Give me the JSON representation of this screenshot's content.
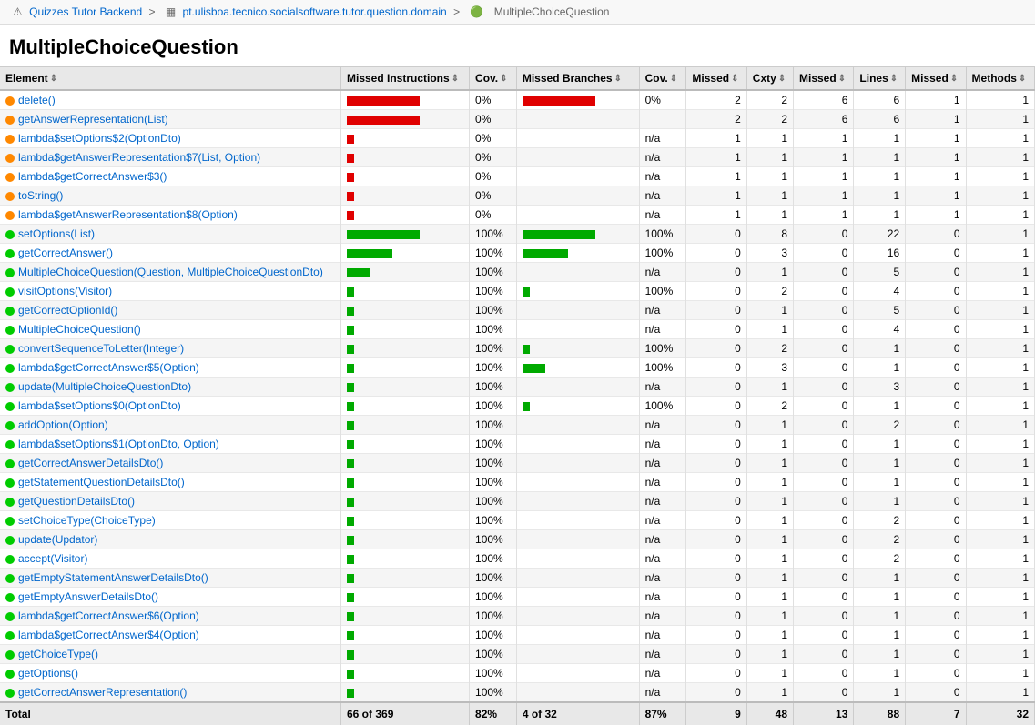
{
  "breadcrumb": {
    "items": [
      {
        "label": "Quizzes Tutor Backend",
        "url": "#"
      },
      {
        "label": "pt.ulisboa.tecnico.socialsoftware.tutor.question.domain",
        "url": "#"
      },
      {
        "label": "MultipleChoiceQuestion",
        "url": "#"
      }
    ]
  },
  "page_title": "MultipleChoiceQuestion",
  "table": {
    "columns": [
      {
        "id": "element",
        "label": "Element",
        "sortable": true
      },
      {
        "id": "missed_instr",
        "label": "Missed Instructions",
        "sortable": true
      },
      {
        "id": "cov_instr",
        "label": "Cov.",
        "sortable": true
      },
      {
        "id": "missed_branches",
        "label": "Missed Branches",
        "sortable": true
      },
      {
        "id": "cov_branches",
        "label": "Cov.",
        "sortable": true
      },
      {
        "id": "missed_cxty",
        "label": "Missed",
        "sortable": true
      },
      {
        "id": "cxty",
        "label": "Cxty",
        "sortable": true
      },
      {
        "id": "missed_lines",
        "label": "Missed",
        "sortable": true
      },
      {
        "id": "lines",
        "label": "Lines",
        "sortable": true
      },
      {
        "id": "missed_methods",
        "label": "Missed",
        "sortable": true
      },
      {
        "id": "methods",
        "label": "Methods",
        "sortable": true
      }
    ],
    "rows": [
      {
        "element": "delete()",
        "dot": "orange",
        "missed_instr_bar": "full_red",
        "cov_instr": "0%",
        "missed_branches_bar": "full_red",
        "cov_branches": "0%",
        "missed_cxty": "2",
        "cxty": "2",
        "missed_lines": "6",
        "lines": "6",
        "missed_methods": "1",
        "methods": "1"
      },
      {
        "element": "getAnswerRepresentation(List)",
        "dot": "orange",
        "missed_instr_bar": "full_red",
        "cov_instr": "0%",
        "missed_branches_bar": "none",
        "cov_branches": "",
        "missed_cxty": "2",
        "cxty": "2",
        "missed_lines": "6",
        "lines": "6",
        "missed_methods": "1",
        "methods": "1"
      },
      {
        "element": "lambda$setOptions$2(OptionDto)",
        "dot": "orange",
        "missed_instr_bar": "tiny_red",
        "cov_instr": "0%",
        "missed_branches_bar": "none",
        "cov_branches": "n/a",
        "missed_cxty": "1",
        "cxty": "1",
        "missed_lines": "1",
        "lines": "1",
        "missed_methods": "1",
        "methods": "1"
      },
      {
        "element": "lambda$getAnswerRepresentation$7(List, Option)",
        "dot": "orange",
        "missed_instr_bar": "tiny_red",
        "cov_instr": "0%",
        "missed_branches_bar": "none",
        "cov_branches": "n/a",
        "missed_cxty": "1",
        "cxty": "1",
        "missed_lines": "1",
        "lines": "1",
        "missed_methods": "1",
        "methods": "1"
      },
      {
        "element": "lambda$getCorrectAnswer$3()",
        "dot": "orange",
        "missed_instr_bar": "tiny_red",
        "cov_instr": "0%",
        "missed_branches_bar": "none",
        "cov_branches": "n/a",
        "missed_cxty": "1",
        "cxty": "1",
        "missed_lines": "1",
        "lines": "1",
        "missed_methods": "1",
        "methods": "1"
      },
      {
        "element": "toString()",
        "dot": "orange",
        "missed_instr_bar": "tiny_red",
        "cov_instr": "0%",
        "missed_branches_bar": "none",
        "cov_branches": "n/a",
        "missed_cxty": "1",
        "cxty": "1",
        "missed_lines": "1",
        "lines": "1",
        "missed_methods": "1",
        "methods": "1"
      },
      {
        "element": "lambda$getAnswerRepresentation$8(Option)",
        "dot": "orange",
        "missed_instr_bar": "tiny_red",
        "cov_instr": "0%",
        "missed_branches_bar": "none",
        "cov_branches": "n/a",
        "missed_cxty": "1",
        "cxty": "1",
        "missed_lines": "1",
        "lines": "1",
        "missed_methods": "1",
        "methods": "1"
      },
      {
        "element": "setOptions(List)",
        "dot": "green",
        "missed_instr_bar": "full_green",
        "cov_instr": "100%",
        "missed_branches_bar": "full_green",
        "cov_branches": "100%",
        "missed_cxty": "0",
        "cxty": "8",
        "missed_lines": "0",
        "lines": "22",
        "missed_methods": "0",
        "methods": "1"
      },
      {
        "element": "getCorrectAnswer()",
        "dot": "green",
        "missed_instr_bar": "med_green",
        "cov_instr": "100%",
        "missed_branches_bar": "med_green",
        "cov_branches": "100%",
        "missed_cxty": "0",
        "cxty": "3",
        "missed_lines": "0",
        "lines": "16",
        "missed_methods": "0",
        "methods": "1"
      },
      {
        "element": "MultipleChoiceQuestion(Question, MultipleChoiceQuestionDto)",
        "dot": "green",
        "missed_instr_bar": "sm_green",
        "cov_instr": "100%",
        "missed_branches_bar": "none",
        "cov_branches": "n/a",
        "missed_cxty": "0",
        "cxty": "1",
        "missed_lines": "0",
        "lines": "5",
        "missed_methods": "0",
        "methods": "1"
      },
      {
        "element": "visitOptions(Visitor)",
        "dot": "green",
        "missed_instr_bar": "tiny_green",
        "cov_instr": "100%",
        "missed_branches_bar": "tiny_green",
        "cov_branches": "100%",
        "missed_cxty": "0",
        "cxty": "2",
        "missed_lines": "0",
        "lines": "4",
        "missed_methods": "0",
        "methods": "1"
      },
      {
        "element": "getCorrectOptionId()",
        "dot": "green",
        "missed_instr_bar": "tiny_green",
        "cov_instr": "100%",
        "missed_branches_bar": "none",
        "cov_branches": "n/a",
        "missed_cxty": "0",
        "cxty": "1",
        "missed_lines": "0",
        "lines": "5",
        "missed_methods": "0",
        "methods": "1"
      },
      {
        "element": "MultipleChoiceQuestion()",
        "dot": "green",
        "missed_instr_bar": "tiny_green",
        "cov_instr": "100%",
        "missed_branches_bar": "none",
        "cov_branches": "n/a",
        "missed_cxty": "0",
        "cxty": "1",
        "missed_lines": "0",
        "lines": "4",
        "missed_methods": "0",
        "methods": "1"
      },
      {
        "element": "convertSequenceToLetter(Integer)",
        "dot": "green",
        "missed_instr_bar": "tiny_green",
        "cov_instr": "100%",
        "missed_branches_bar": "tiny_green",
        "cov_branches": "100%",
        "missed_cxty": "0",
        "cxty": "2",
        "missed_lines": "0",
        "lines": "1",
        "missed_methods": "0",
        "methods": "1"
      },
      {
        "element": "lambda$getCorrectAnswer$5(Option)",
        "dot": "green",
        "missed_instr_bar": "tiny_green",
        "cov_instr": "100%",
        "missed_branches_bar": "sm_green",
        "cov_branches": "100%",
        "missed_cxty": "0",
        "cxty": "3",
        "missed_lines": "0",
        "lines": "1",
        "missed_methods": "0",
        "methods": "1"
      },
      {
        "element": "update(MultipleChoiceQuestionDto)",
        "dot": "green",
        "missed_instr_bar": "tiny_green",
        "cov_instr": "100%",
        "missed_branches_bar": "none",
        "cov_branches": "n/a",
        "missed_cxty": "0",
        "cxty": "1",
        "missed_lines": "0",
        "lines": "3",
        "missed_methods": "0",
        "methods": "1"
      },
      {
        "element": "lambda$setOptions$0(OptionDto)",
        "dot": "green",
        "missed_instr_bar": "tiny_green",
        "cov_instr": "100%",
        "missed_branches_bar": "tiny_green",
        "cov_branches": "100%",
        "missed_cxty": "0",
        "cxty": "2",
        "missed_lines": "0",
        "lines": "1",
        "missed_methods": "0",
        "methods": "1"
      },
      {
        "element": "addOption(Option)",
        "dot": "green",
        "missed_instr_bar": "tiny_green",
        "cov_instr": "100%",
        "missed_branches_bar": "none",
        "cov_branches": "n/a",
        "missed_cxty": "0",
        "cxty": "1",
        "missed_lines": "0",
        "lines": "2",
        "missed_methods": "0",
        "methods": "1"
      },
      {
        "element": "lambda$setOptions$1(OptionDto, Option)",
        "dot": "green",
        "missed_instr_bar": "tiny_green",
        "cov_instr": "100%",
        "missed_branches_bar": "none",
        "cov_branches": "n/a",
        "missed_cxty": "0",
        "cxty": "1",
        "missed_lines": "0",
        "lines": "1",
        "missed_methods": "0",
        "methods": "1"
      },
      {
        "element": "getCorrectAnswerDetailsDto()",
        "dot": "green",
        "missed_instr_bar": "tiny_green",
        "cov_instr": "100%",
        "missed_branches_bar": "none",
        "cov_branches": "n/a",
        "missed_cxty": "0",
        "cxty": "1",
        "missed_lines": "0",
        "lines": "1",
        "missed_methods": "0",
        "methods": "1"
      },
      {
        "element": "getStatementQuestionDetailsDto()",
        "dot": "green",
        "missed_instr_bar": "tiny_green",
        "cov_instr": "100%",
        "missed_branches_bar": "none",
        "cov_branches": "n/a",
        "missed_cxty": "0",
        "cxty": "1",
        "missed_lines": "0",
        "lines": "1",
        "missed_methods": "0",
        "methods": "1"
      },
      {
        "element": "getQuestionDetailsDto()",
        "dot": "green",
        "missed_instr_bar": "tiny_green",
        "cov_instr": "100%",
        "missed_branches_bar": "none",
        "cov_branches": "n/a",
        "missed_cxty": "0",
        "cxty": "1",
        "missed_lines": "0",
        "lines": "1",
        "missed_methods": "0",
        "methods": "1"
      },
      {
        "element": "setChoiceType(ChoiceType)",
        "dot": "green",
        "missed_instr_bar": "tiny_green",
        "cov_instr": "100%",
        "missed_branches_bar": "none",
        "cov_branches": "n/a",
        "missed_cxty": "0",
        "cxty": "1",
        "missed_lines": "0",
        "lines": "2",
        "missed_methods": "0",
        "methods": "1"
      },
      {
        "element": "update(Updator)",
        "dot": "green",
        "missed_instr_bar": "tiny_green",
        "cov_instr": "100%",
        "missed_branches_bar": "none",
        "cov_branches": "n/a",
        "missed_cxty": "0",
        "cxty": "1",
        "missed_lines": "0",
        "lines": "2",
        "missed_methods": "0",
        "methods": "1"
      },
      {
        "element": "accept(Visitor)",
        "dot": "green",
        "missed_instr_bar": "tiny_green",
        "cov_instr": "100%",
        "missed_branches_bar": "none",
        "cov_branches": "n/a",
        "missed_cxty": "0",
        "cxty": "1",
        "missed_lines": "0",
        "lines": "2",
        "missed_methods": "0",
        "methods": "1"
      },
      {
        "element": "getEmptyStatementAnswerDetailsDto()",
        "dot": "green",
        "missed_instr_bar": "tiny_green",
        "cov_instr": "100%",
        "missed_branches_bar": "none",
        "cov_branches": "n/a",
        "missed_cxty": "0",
        "cxty": "1",
        "missed_lines": "0",
        "lines": "1",
        "missed_methods": "0",
        "methods": "1"
      },
      {
        "element": "getEmptyAnswerDetailsDto()",
        "dot": "green",
        "missed_instr_bar": "tiny_green",
        "cov_instr": "100%",
        "missed_branches_bar": "none",
        "cov_branches": "n/a",
        "missed_cxty": "0",
        "cxty": "1",
        "missed_lines": "0",
        "lines": "1",
        "missed_methods": "0",
        "methods": "1"
      },
      {
        "element": "lambda$getCorrectAnswer$6(Option)",
        "dot": "green",
        "missed_instr_bar": "tiny_green",
        "cov_instr": "100%",
        "missed_branches_bar": "none",
        "cov_branches": "n/a",
        "missed_cxty": "0",
        "cxty": "1",
        "missed_lines": "0",
        "lines": "1",
        "missed_methods": "0",
        "methods": "1"
      },
      {
        "element": "lambda$getCorrectAnswer$4(Option)",
        "dot": "green",
        "missed_instr_bar": "tiny_green",
        "cov_instr": "100%",
        "missed_branches_bar": "none",
        "cov_branches": "n/a",
        "missed_cxty": "0",
        "cxty": "1",
        "missed_lines": "0",
        "lines": "1",
        "missed_methods": "0",
        "methods": "1"
      },
      {
        "element": "getChoiceType()",
        "dot": "green",
        "missed_instr_bar": "tiny_green",
        "cov_instr": "100%",
        "missed_branches_bar": "none",
        "cov_branches": "n/a",
        "missed_cxty": "0",
        "cxty": "1",
        "missed_lines": "0",
        "lines": "1",
        "missed_methods": "0",
        "methods": "1"
      },
      {
        "element": "getOptions()",
        "dot": "green",
        "missed_instr_bar": "tiny_green",
        "cov_instr": "100%",
        "missed_branches_bar": "none",
        "cov_branches": "n/a",
        "missed_cxty": "0",
        "cxty": "1",
        "missed_lines": "0",
        "lines": "1",
        "missed_methods": "0",
        "methods": "1"
      },
      {
        "element": "getCorrectAnswerRepresentation()",
        "dot": "green",
        "missed_instr_bar": "tiny_green",
        "cov_instr": "100%",
        "missed_branches_bar": "none",
        "cov_branches": "n/a",
        "missed_cxty": "0",
        "cxty": "1",
        "missed_lines": "0",
        "lines": "1",
        "missed_methods": "0",
        "methods": "1"
      }
    ],
    "footer": {
      "label": "Total",
      "missed_instr": "66 of 369",
      "cov_instr": "82%",
      "missed_branches": "4 of 32",
      "cov_branches": "87%",
      "missed_cxty": "9",
      "cxty": "48",
      "missed_lines": "13",
      "lines": "88",
      "missed_methods": "7",
      "methods": "32"
    }
  }
}
